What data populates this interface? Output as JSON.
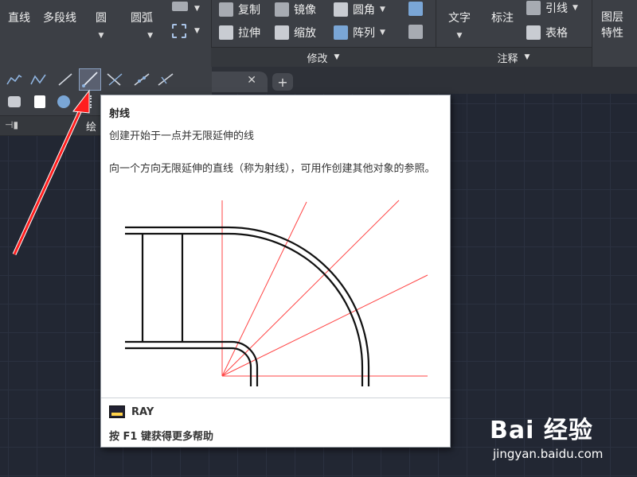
{
  "ribbon": {
    "draw": {
      "line": "直线",
      "polyline": "多段线",
      "circle": "圆",
      "arc": "圆弧"
    },
    "modify": {
      "copy": "复制",
      "mirror": "镜像",
      "fillet": "圆角",
      "stretch": "拉伸",
      "scale": "缩放",
      "array": "阵列",
      "panel_label": "修改"
    },
    "annotation": {
      "text": "文字",
      "dimension": "标注",
      "leader": "引线",
      "table": "表格",
      "panel_label": "注释"
    },
    "layers": {
      "label_line1": "图层",
      "label_line2": "特性"
    }
  },
  "draw_panel": {
    "label": "绘"
  },
  "tooltip": {
    "title": "射线",
    "description": "创建开始于一点并无限延伸的线",
    "long_description": "向一个方向无限延伸的直线（称为射线），可用作创建其他对象的参照。",
    "command": "RAY",
    "help": "按 F1 键获得更多帮助"
  },
  "watermark": {
    "brand": "Bai 经验",
    "url": "jingyan.baidu.com"
  },
  "colors": {
    "ray": "#ff3b3b",
    "arrow": "#ff1e1e",
    "ribbon": "#3c3f45",
    "canvas": "#222733"
  }
}
